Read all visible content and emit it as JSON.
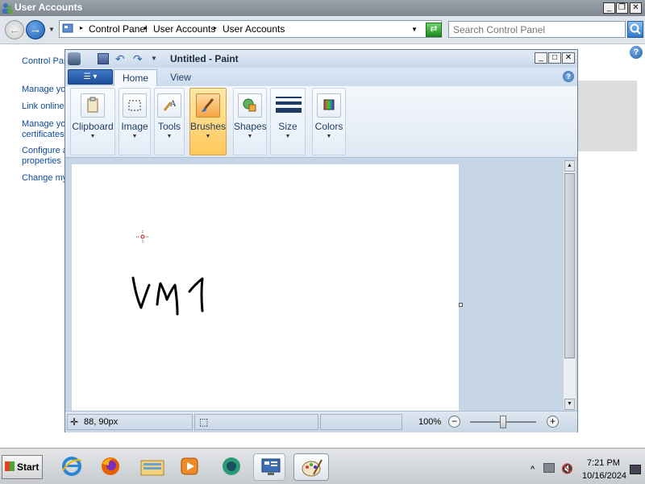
{
  "explorer": {
    "title": "User Accounts",
    "breadcrumb": [
      "Control Panel",
      "User Accounts",
      "User Accounts"
    ],
    "search_placeholder": "Search Control Panel",
    "links": [
      "Control Pan",
      "Manage yo",
      "Link online",
      "Manage yo",
      "certificates",
      "Configure a",
      "properties",
      "Change my"
    ],
    "help_glyph": "?"
  },
  "paint": {
    "title": "Untitled - Paint",
    "tabs": [
      "Home",
      "View"
    ],
    "groups": [
      {
        "label": "Clipboard",
        "icon": "clipboard-icon"
      },
      {
        "label": "Image",
        "icon": "select-icon"
      },
      {
        "label": "Tools",
        "icon": "tools-icon"
      },
      {
        "label": "Brushes",
        "icon": "brush-icon"
      },
      {
        "label": "Shapes",
        "icon": "shapes-icon"
      },
      {
        "label": "Size",
        "icon": "size-icon"
      },
      {
        "label": "Colors",
        "icon": "colors-icon"
      }
    ],
    "canvas_text": "VM1",
    "status": {
      "position": "88, 90px",
      "zoom": "100%"
    }
  },
  "taskbar": {
    "start_label": "Start",
    "apps": [
      "internet-explorer-icon",
      "firefox-icon",
      "file-explorer-icon",
      "media-player-icon",
      "live-messenger-icon",
      "remote-desktop-icon",
      "paint-icon"
    ],
    "clock_time": "7:21 PM",
    "clock_date": "10/16/2024"
  }
}
